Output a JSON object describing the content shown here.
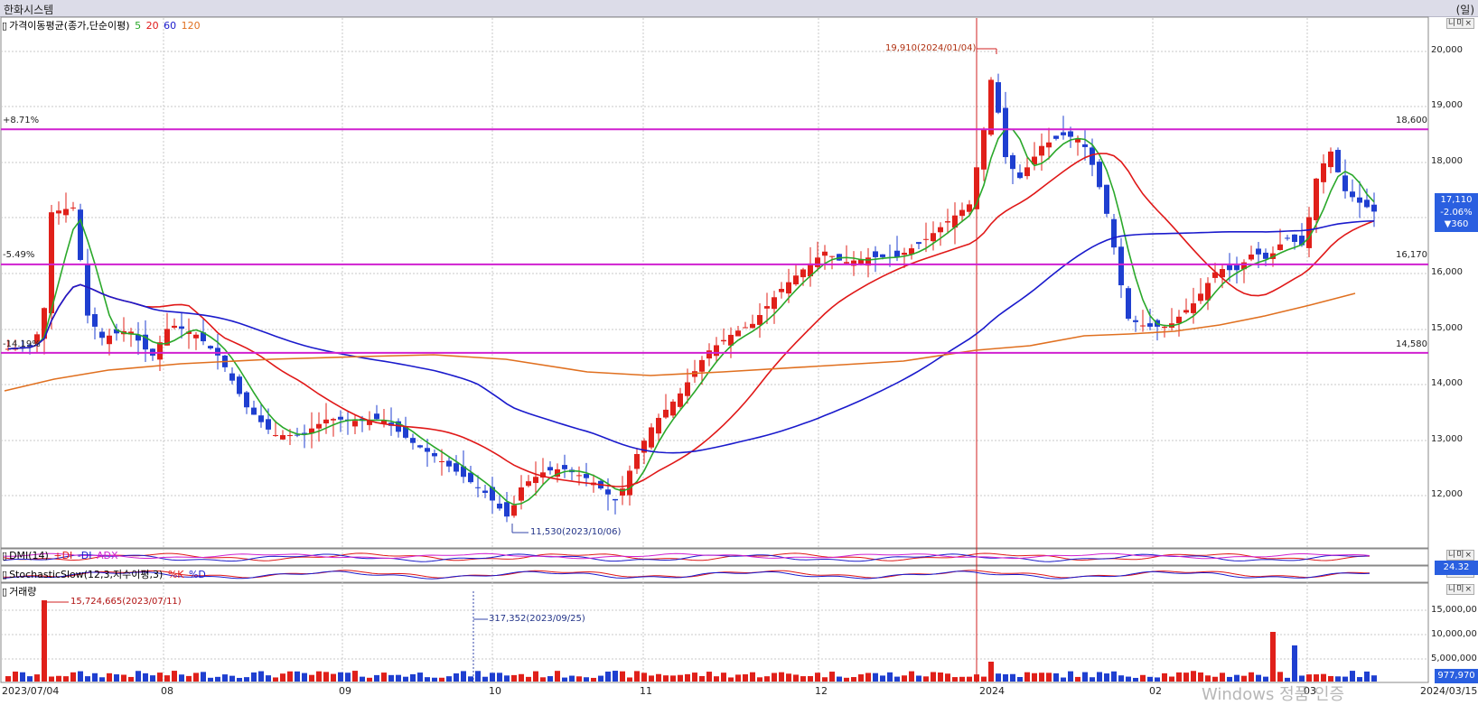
{
  "window": {
    "title": "한화시스템",
    "period_tag": "(일)"
  },
  "legends": {
    "price": {
      "label": "가격이동평균(종가,단순이평)",
      "periods": [
        "5",
        "20",
        "60",
        "120"
      ]
    },
    "dmi": {
      "label": "DMI(14)",
      "items": [
        "+DI",
        "-DI",
        "ADX"
      ]
    },
    "stoch": {
      "label": "StochasticSlow(12,3,지수이평,3)",
      "items": [
        "%K",
        "%D"
      ]
    },
    "volume": {
      "label": "거래량"
    }
  },
  "panel_controls": "니미×",
  "colors": {
    "up": "#e0201a",
    "down": "#1f3fd0",
    "ma5": "#2aa82a",
    "ma20": "#e01818",
    "ma60": "#1a1acc",
    "ma120": "#e07020",
    "level": "#d020d0",
    "marker": "#d02020"
  },
  "price_axis": [
    "20,000",
    "19,000",
    "18,000",
    "17,000",
    "16,000",
    "15,000",
    "14,000",
    "13,000",
    "12,000"
  ],
  "volume_axis": [
    "15,000,00",
    "10,000,00",
    "5,000,000"
  ],
  "levels": [
    {
      "pct": "+8.71%",
      "price": "18,600"
    },
    {
      "pct": "-5.49%",
      "price": "16,170"
    },
    {
      "pct": "-14.19%",
      "price": "14,580"
    }
  ],
  "annotations": {
    "high": "19,910(2024/01/04)",
    "low": "11,530(2023/10/06)",
    "vol_high": "15,724,665(2023/07/11)",
    "vol_low": "317,352(2023/09/25)"
  },
  "current": {
    "price": "17,110",
    "change_pct": "-2.06%",
    "change": "▼360",
    "dmi_value": "24.32",
    "volume": "977,970"
  },
  "x_axis": [
    "2023/07/04",
    "08",
    "09",
    "10",
    "11",
    "12",
    "2024",
    "02",
    "03",
    "2024/03/15"
  ],
  "watermark": "Windows 정품 인증"
}
